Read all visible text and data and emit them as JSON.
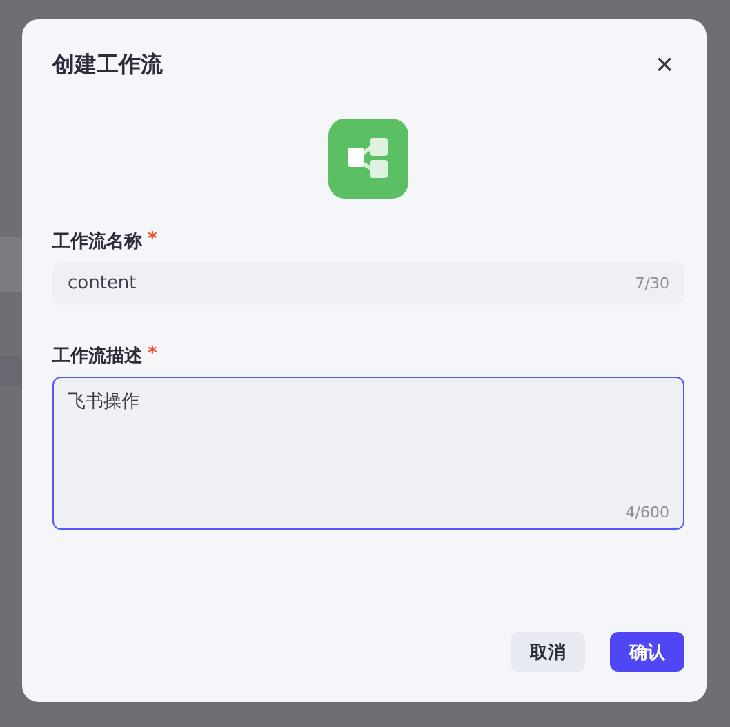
{
  "dialog": {
    "title": "创建工作流",
    "close": "×"
  },
  "fields": [
    {
      "kind": "input",
      "label": "工作流名称",
      "required_mark": "*",
      "value": "content",
      "count": "7/30",
      "focused": false
    },
    {
      "kind": "textarea",
      "label": "工作流描述",
      "required_mark": "*",
      "value": "飞书操作",
      "count": "4/600",
      "focused": true
    }
  ],
  "buttons": [
    {
      "label": "取消",
      "primary": false
    },
    {
      "label": "确认",
      "primary": true
    }
  ]
}
